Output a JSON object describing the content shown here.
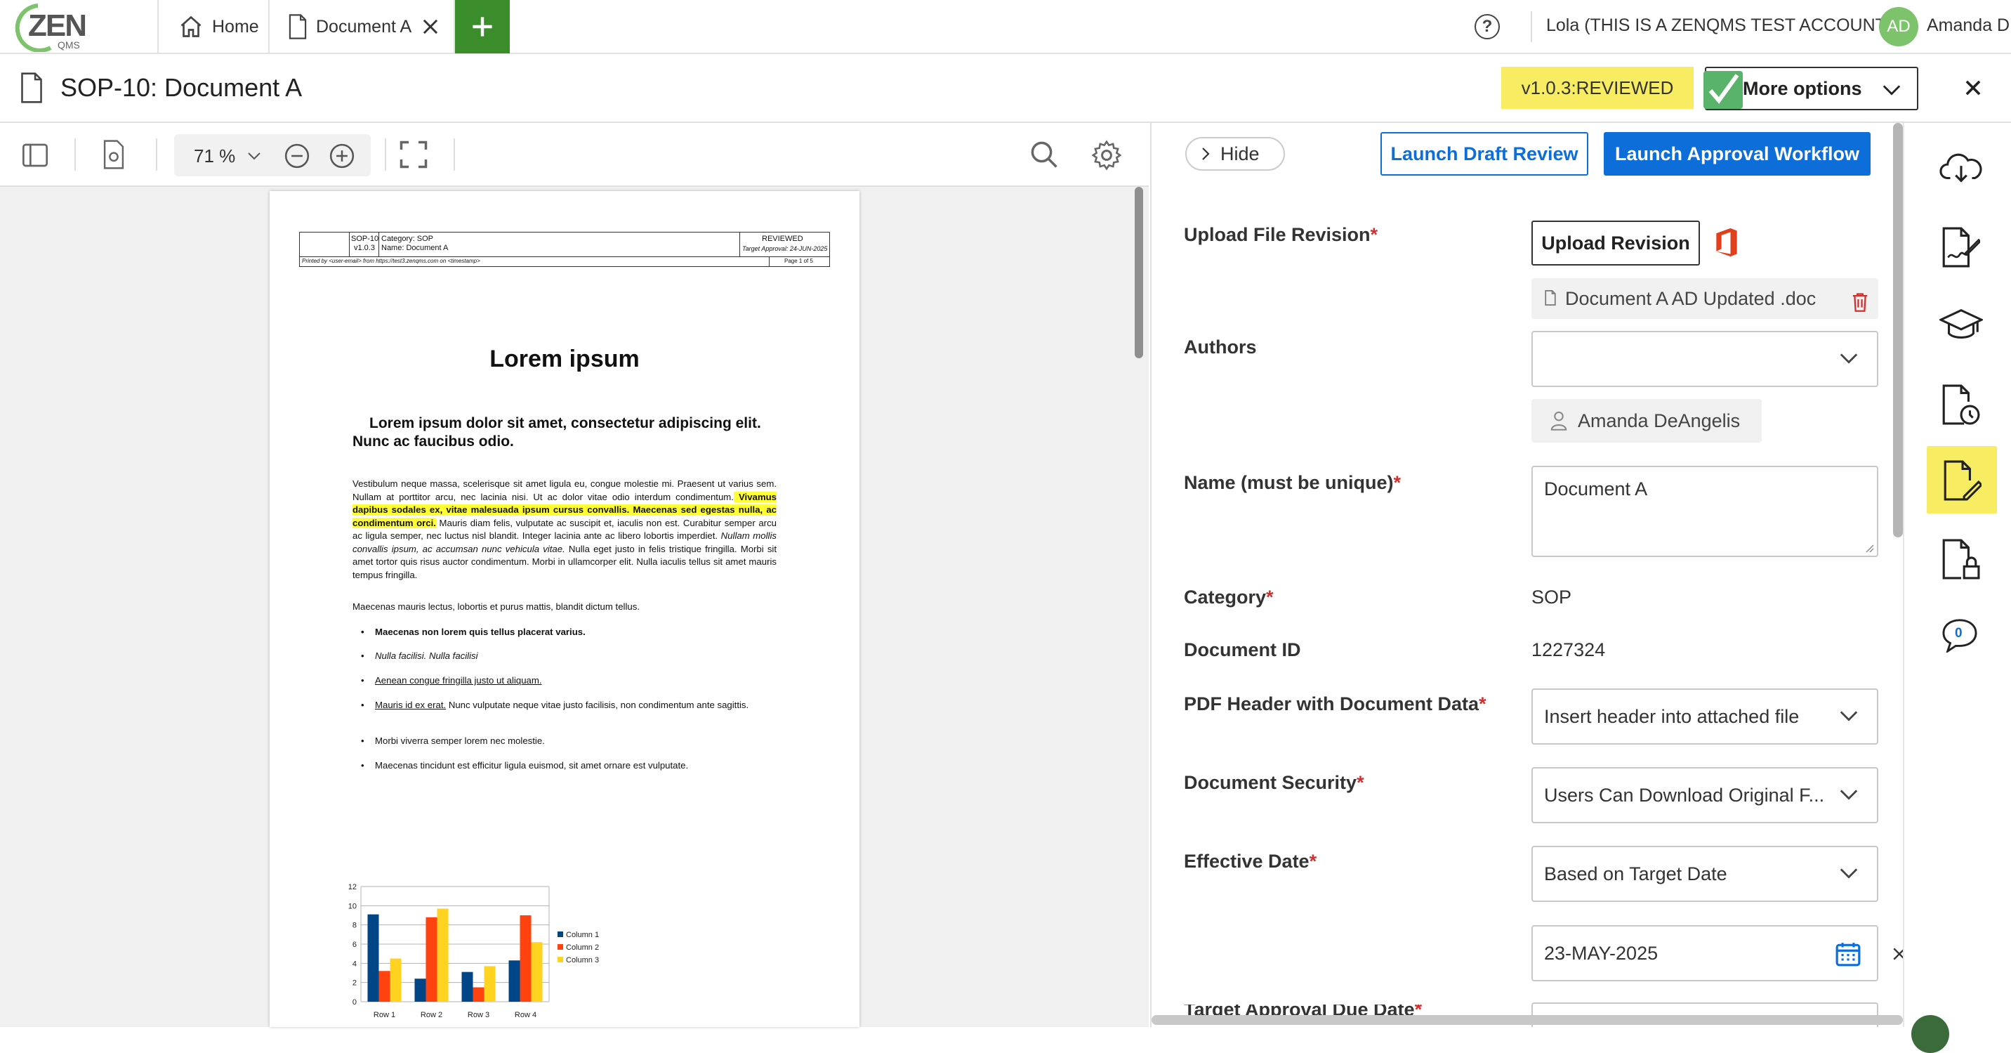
{
  "app": {
    "logo_text": "ZEN",
    "logo_sub": "QMS"
  },
  "tabs": [
    {
      "label": "Home",
      "icon": "home-icon"
    },
    {
      "label": "Document A",
      "icon": "document-icon"
    }
  ],
  "header_right": {
    "account": "Lola (THIS IS A ZENQMS TEST ACCOUNT)",
    "avatar_initials": "AD",
    "user_name": "Amanda D"
  },
  "document": {
    "title": "SOP-10: Document A",
    "version_badge": "v1.0.3:REVIEWED",
    "more_options": "More options"
  },
  "viewer": {
    "zoom": "71 %"
  },
  "pdf": {
    "hdr_id": "SOP-10",
    "hdr_ver": "v1.0.3",
    "hdr_category": "Category: SOP",
    "hdr_name": "Name: Document A",
    "hdr_status": "REVIEWED",
    "hdr_target": "Target Approval: 24-JUN-2025",
    "hdr_printed": "Printed by <user-email> from https://test3.zenqms.com on <timestamp>",
    "hdr_page": "Page 1 of 5",
    "heading": "Lorem ipsum",
    "subheading": "Lorem ipsum dolor sit amet, consectetur adipiscing elit. Nunc ac faucibus odio.",
    "para1_a": "Vestibulum neque massa, scelerisque sit amet ligula eu, congue molestie mi. Praesent ut varius sem. Nullam at porttitor arcu, nec lacinia nisi. Ut ac dolor vitae odio interdum condimentum.",
    "para1_hl": " Vivamus dapibus sodales ex, vitae malesuada ipsum cursus convallis. Maecenas sed egestas nulla, ac condimentum orci.",
    "para1_b": " Mauris diam felis, vulputate ac suscipit et, iaculis non est. Curabitur semper arcu ac ligula semper, nec luctus nisl blandit. Integer lacinia ante ac libero lobortis imperdiet.",
    "para1_it": " Nullam mollis convallis ipsum, ac accumsan nunc vehicula vitae.",
    "para1_c": " Nulla eget justo in felis tristique fringilla. Morbi sit amet tortor quis risus auctor condimentum. Morbi in ullamcorper elit. Nulla iaculis tellus sit amet mauris tempus fringilla.",
    "para2": "Maecenas mauris lectus, lobortis et purus mattis, blandit dictum tellus.",
    "bullets": [
      "Maecenas non lorem quis tellus placerat varius.",
      "Nulla facilisi. Nulla facilisi",
      "Aenean congue fringilla justo ut aliquam.",
      "Mauris id ex erat.",
      " Nunc vulputate neque vitae justo facilisis, non condimentum ante sagittis.",
      "Morbi viverra semper lorem nec molestie.",
      "Maecenas tincidunt est efficitur ligula euismod, sit amet ornare est vulputate."
    ]
  },
  "chart_data": {
    "type": "bar",
    "categories": [
      "Row 1",
      "Row 2",
      "Row 3",
      "Row 4"
    ],
    "series": [
      {
        "name": "Column 1",
        "values": [
          9.1,
          2.4,
          3.1,
          4.3
        ],
        "color": "#004586"
      },
      {
        "name": "Column 2",
        "values": [
          3.2,
          8.8,
          1.5,
          9.0
        ],
        "color": "#ff420e"
      },
      {
        "name": "Column 3",
        "values": [
          4.5,
          9.7,
          3.7,
          6.2
        ],
        "color": "#ffd320"
      }
    ],
    "ylim": [
      0,
      12
    ],
    "yticks": [
      "0",
      "2",
      "4",
      "6",
      "8",
      "10",
      "12"
    ],
    "grid": true,
    "legend": "right"
  },
  "panel": {
    "hide": "Hide",
    "launch_draft": "Launch Draft Review",
    "launch_approval": "Launch Approval Workflow",
    "upload_label": "Upload File Revision",
    "upload_button": "Upload Revision",
    "attached_file": "Document A AD Updated .doc",
    "authors_label": "Authors",
    "author_chip": "Amanda DeAngelis",
    "name_label": "Name (must be unique)",
    "name_value": "Document A",
    "category_label": "Category",
    "category_value": "SOP",
    "docid_label": "Document ID",
    "docid_value": "1227324",
    "pdfheader_label": "PDF Header with Document Data",
    "pdfheader_value": "Insert header into attached file",
    "security_label": "Document Security",
    "security_value": "Users Can Download Original F...",
    "effective_label": "Effective Date",
    "effective_value": "Based on Target Date",
    "date_value": "23-MAY-2025",
    "cut_label": "Target Approval Due Date"
  },
  "rail": {
    "comment_count": "0"
  },
  "colors": {
    "primary": "#0d6ed9",
    "badge": "#f7ec62",
    "green_tab": "#3b8c2a",
    "required": "#d32f2f"
  }
}
